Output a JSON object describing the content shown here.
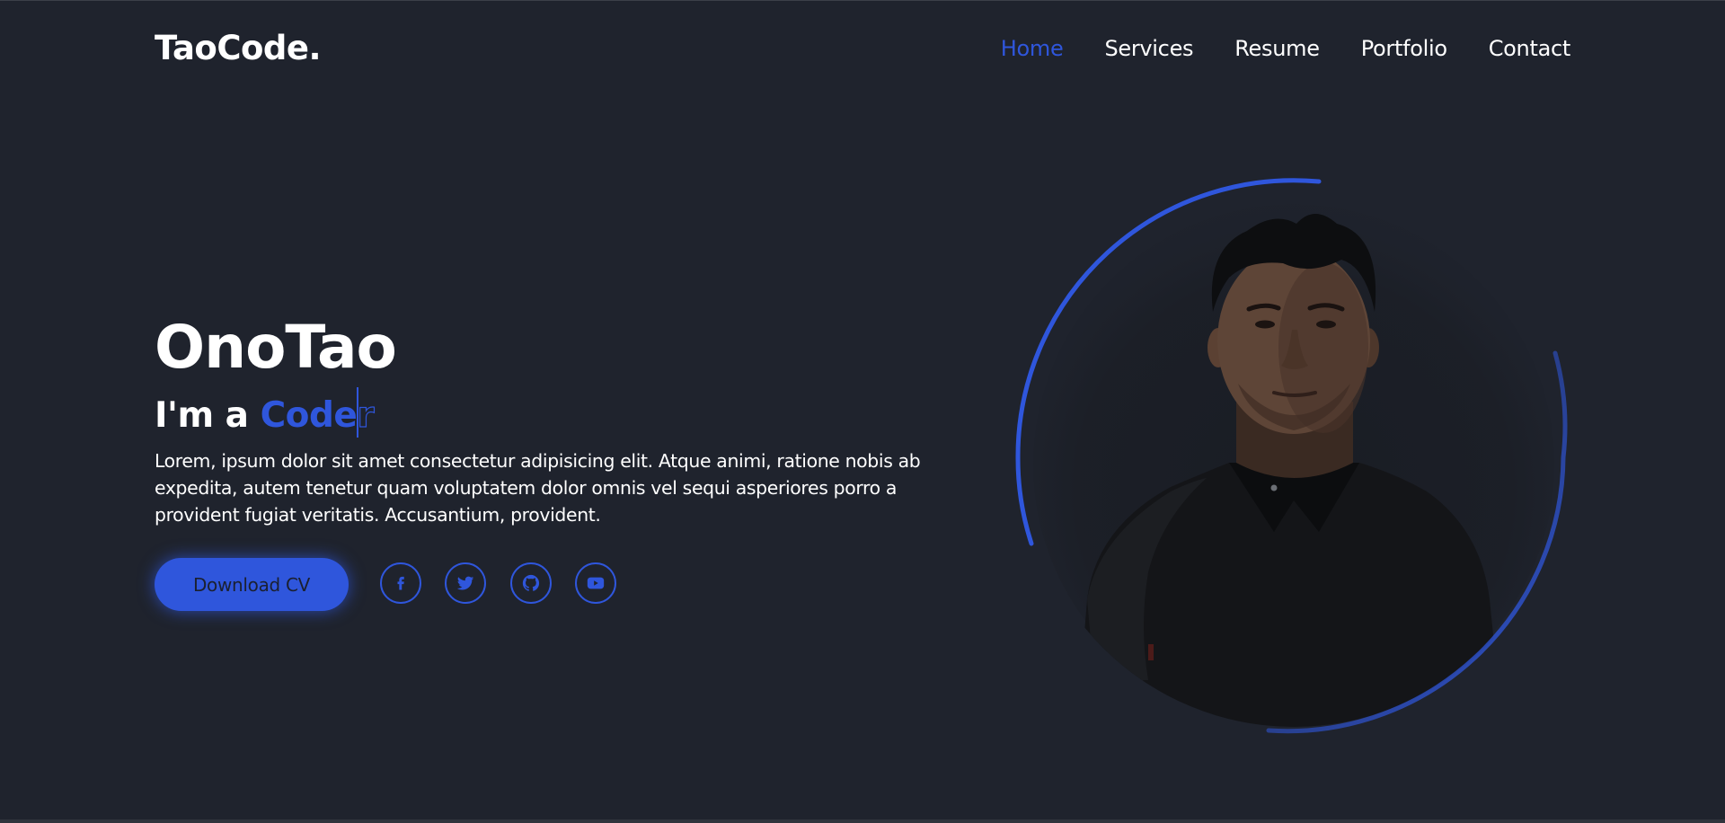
{
  "logo": "TaoCode.",
  "nav": {
    "items": [
      {
        "label": "Home",
        "active": true
      },
      {
        "label": "Services"
      },
      {
        "label": "Resume"
      },
      {
        "label": "Portfolio"
      },
      {
        "label": "Contact"
      }
    ]
  },
  "hero": {
    "name": "OnoTao",
    "role_prefix": "I'm a ",
    "role_typed": "Code",
    "role_rest": "r",
    "description": "Lorem, ipsum dolor sit amet consectetur adipisicing elit. Atque animi, ratione nobis ab expedita, autem tenetur quam voluptatem dolor omnis vel sequi asperiores porro a provident fugiat veritatis. Accusantium, provident.",
    "cv_button": "Download CV"
  },
  "social": [
    {
      "icon": "facebook-icon"
    },
    {
      "icon": "twitter-icon"
    },
    {
      "icon": "github-icon"
    },
    {
      "icon": "youtube-icon"
    }
  ],
  "colors": {
    "background": "#1f232d",
    "accent": "#2f56dc",
    "text": "#ffffff"
  }
}
